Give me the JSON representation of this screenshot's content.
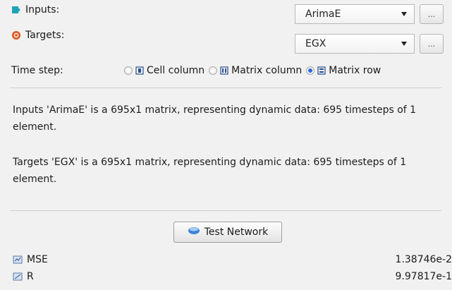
{
  "inputs": {
    "label": "Inputs:",
    "selected": "ArimaE",
    "browse_label": "..."
  },
  "targets": {
    "label": "Targets:",
    "selected": "EGX",
    "browse_label": "..."
  },
  "time_step": {
    "label": "Time step:",
    "options": [
      {
        "label": "Cell column",
        "selected": false
      },
      {
        "label": "Matrix column",
        "selected": false
      },
      {
        "label": "Matrix row",
        "selected": true
      }
    ]
  },
  "info": {
    "inputs_text": "Inputs 'ArimaE' is a 695x1 matrix, representing dynamic data: 695 timesteps of 1 element.",
    "targets_text": "Targets 'EGX' is a 695x1 matrix, representing dynamic data: 695 timesteps of 1 element."
  },
  "test_button": {
    "label": "Test Network"
  },
  "metrics": [
    {
      "name": "MSE",
      "value": "1.38746e-2"
    },
    {
      "name": "R",
      "value": "9.97817e-1"
    }
  ],
  "colors": {
    "accent": "#2a6fd3",
    "inputs_icon": "#1fa3b8",
    "targets_icon": "#d9531e"
  }
}
